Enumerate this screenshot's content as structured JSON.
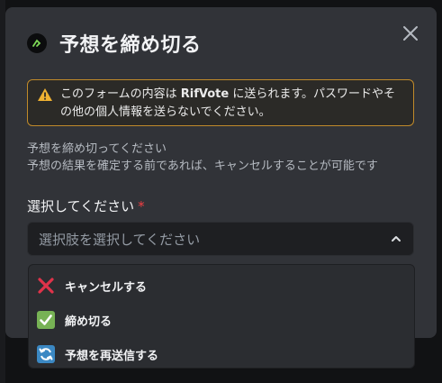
{
  "modal": {
    "title": "予想を締め切る",
    "warning_pre": "このフォームの内容は ",
    "warning_app": "RifVote",
    "warning_post": " に送られます。パスワードやその他の個人情報を送らないでください。",
    "description_line1": "予想を締め切ってください",
    "description_line2": "予想の結果を確定する前であれば、キャンセルすることが可能です",
    "field_label": "選択してください",
    "required_mark": "*",
    "select_placeholder": "選択肢を選択してください"
  },
  "options": [
    {
      "label": "キャンセルする",
      "icon": "cross-mark-icon"
    },
    {
      "label": "締め切る",
      "icon": "check-mark-icon"
    },
    {
      "label": "予想を再送信する",
      "icon": "refresh-icon"
    }
  ],
  "colors": {
    "modal_bg": "#313338",
    "warning_border": "#c08a2a",
    "required": "#f23f43",
    "cross": "#e0334a",
    "check_bg": "#77b255",
    "refresh_bg": "#3b88c3"
  }
}
